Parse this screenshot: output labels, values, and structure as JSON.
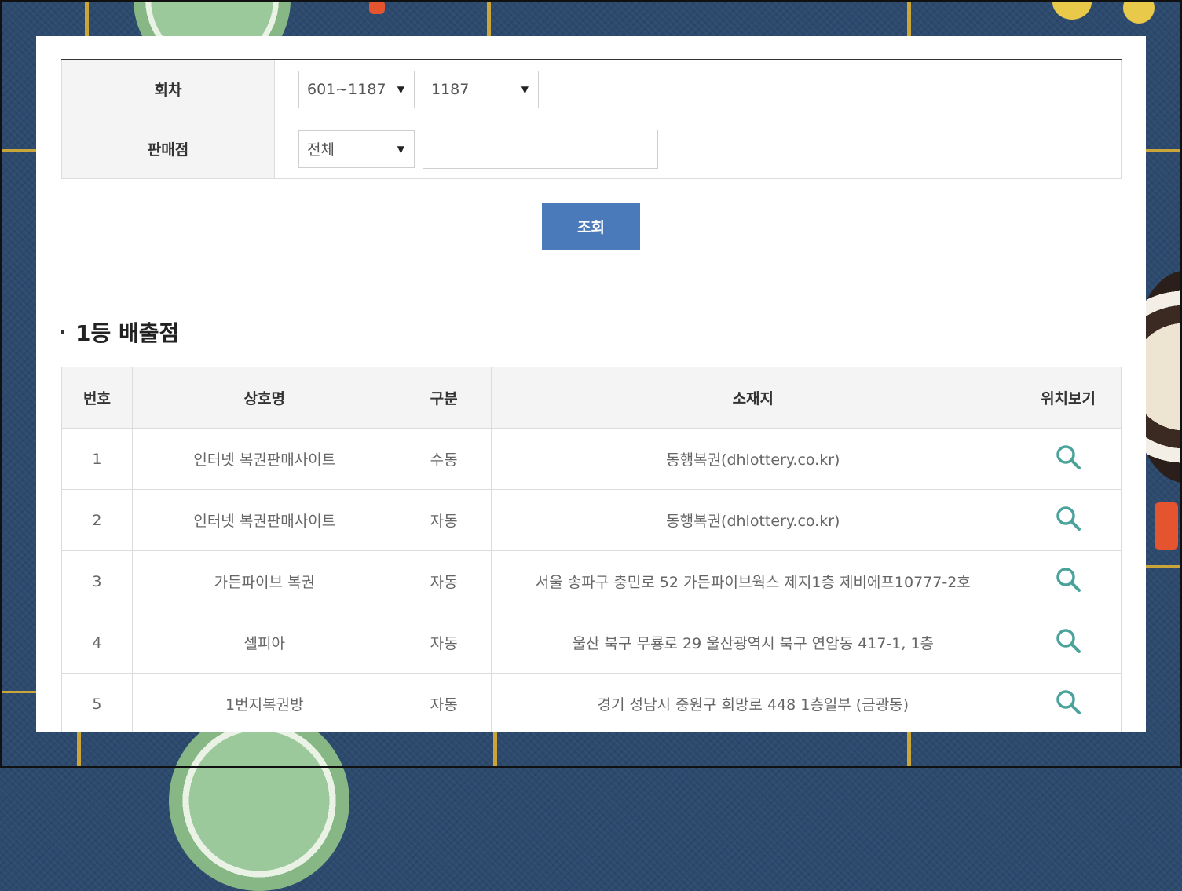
{
  "search_form": {
    "round_label": "회차",
    "round_range_value": "601~1187",
    "round_value": "1187",
    "shop_label": "판매점",
    "shop_type_value": "전체",
    "shop_name_value": "",
    "search_button_label": "조회"
  },
  "section_title": "1등 배출점",
  "results": {
    "headers": [
      "번호",
      "상호명",
      "구분",
      "소재지",
      "위치보기"
    ],
    "rows": [
      {
        "no": "1",
        "name": "인터넷 복권판매사이트",
        "type": "수동",
        "address": "동행복권(dhlottery.co.kr)"
      },
      {
        "no": "2",
        "name": "인터넷 복권판매사이트",
        "type": "자동",
        "address": "동행복권(dhlottery.co.kr)"
      },
      {
        "no": "3",
        "name": "가든파이브 복권",
        "type": "자동",
        "address": "서울 송파구 충민로 52 가든파이브웍스 제지1층 제비에프10777-2호"
      },
      {
        "no": "4",
        "name": "셀피아",
        "type": "자동",
        "address": "울산 북구 무룡로 29 울산광역시 북구 연암동 417-1, 1층"
      },
      {
        "no": "5",
        "name": "1번지복권방",
        "type": "자동",
        "address": "경기 성남시 중원구 희망로 448 1층일부 (금광동)"
      }
    ]
  },
  "colors": {
    "search_button": "#4a7ab9",
    "magnifier_icon": "#4aa39a",
    "background": "#2c4a6e"
  },
  "icons": {
    "dropdown": "chevron-down-icon",
    "location": "search-icon"
  }
}
